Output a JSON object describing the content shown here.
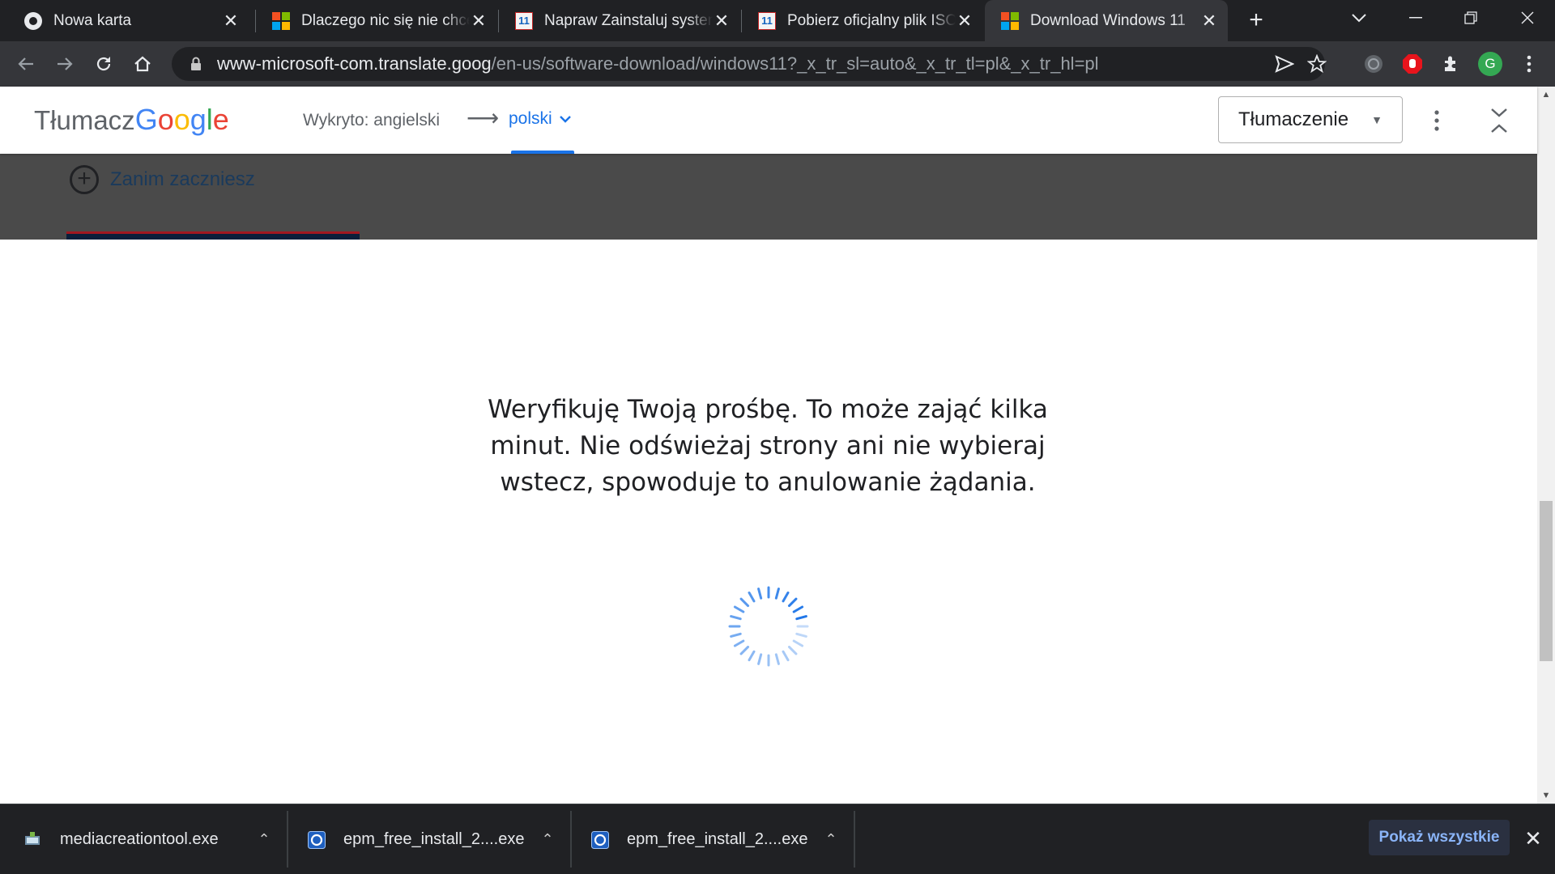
{
  "browser": {
    "tabs": [
      {
        "title": "Nowa karta",
        "favicon": "chrome-icon"
      },
      {
        "title": "Dlaczego nic się nie chce zainstalować",
        "favicon": "microsoft-icon"
      },
      {
        "title": "Napraw Zainstaluj system",
        "favicon": "windows11-site-icon"
      },
      {
        "title": "Pobierz oficjalny plik ISO systemu",
        "favicon": "windows11-site-icon"
      },
      {
        "title": "Download Windows 11",
        "favicon": "microsoft-icon",
        "active": true
      }
    ],
    "close_glyph": "✕",
    "new_tab_glyph": "+",
    "window_controls": {
      "minimize": "—",
      "restore": "❐",
      "close": "✕",
      "tab_search": "⌄"
    }
  },
  "toolbar": {
    "url_host": "www-microsoft-com.translate.goog",
    "url_path": "/en-us/software-download/windows11?_x_tr_sl=auto&_x_tr_tl=pl&_x_tr_hl=pl",
    "profile_initial": "G"
  },
  "translate_bar": {
    "logo_prefix": "Tłumacz",
    "logo_google": [
      "G",
      "o",
      "o",
      "g",
      "l",
      "e"
    ],
    "detected": "Wykryto: angielski",
    "arrow": "⟶",
    "target_language": "polski",
    "mode": "Tłumaczenie"
  },
  "page": {
    "section_label": "Zanim zaczniesz",
    "verify_message": "Weryfikuję Twoją prośbę. To może zająć kilka minut. Nie odświeżaj strony ani nie wybieraj wstecz, spowoduje to anulowanie żądania."
  },
  "downloads": {
    "items": [
      {
        "name": "mediacreationtool.exe"
      },
      {
        "name": "epm_free_install_2....exe"
      },
      {
        "name": "epm_free_install_2....exe"
      }
    ],
    "chevron": "⌃",
    "show_all": "Pokaż wszystkie",
    "close": "✕"
  },
  "colors": {
    "tabstrip": "#202124",
    "toolbar": "#35363a",
    "accent_blue": "#1a73e8",
    "dark_band": "#4a4a4a",
    "spinner": "#1a73e8"
  }
}
